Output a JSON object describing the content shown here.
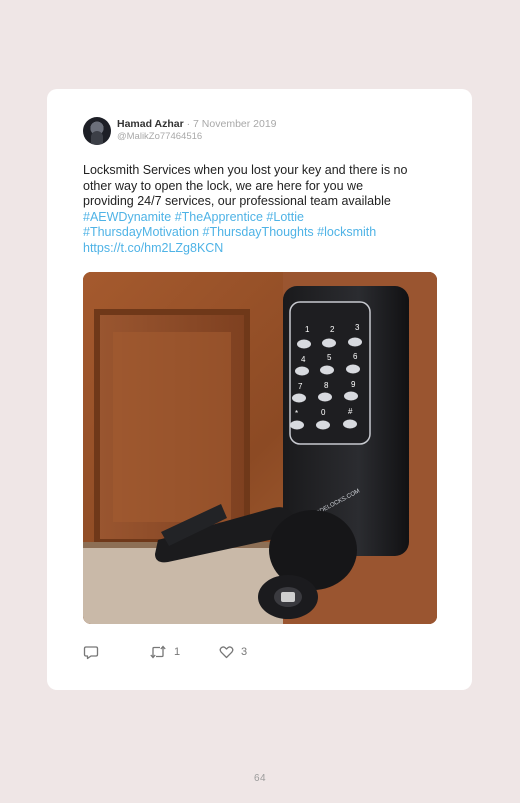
{
  "tweet": {
    "author_name": "Hamad Azhar",
    "date": " · 7 November 2019",
    "handle": "@MalikZo77464516",
    "text_lines": [
      "Locksmith Services when you lost your key and there is no",
      "other way to open the lock, we are here for you we",
      "providing 24/7 services, our professional team available"
    ],
    "hashtags_line1": "#AEWDynamite #TheApprentice #Lottie",
    "hashtags_line2": "#ThursdayMotivation #ThursdayThoughts #locksmith",
    "link": "https://t.co/hm2LZg8KCN",
    "image_brand_text": "CODELOCKS.COM",
    "keypad_keys": [
      "1",
      "2",
      "3",
      "4",
      "5",
      "6",
      "7",
      "8",
      "9",
      "*",
      "0",
      "#"
    ],
    "actions": {
      "reply_icon": "reply-icon",
      "retweet_icon": "retweet-icon",
      "retweet_count": "1",
      "like_icon": "heart-icon",
      "like_count": "3"
    }
  },
  "page": {
    "number": "64"
  },
  "colors": {
    "background": "#efe6e6",
    "card": "#ffffff",
    "hashtag": "#4fb3e6"
  }
}
